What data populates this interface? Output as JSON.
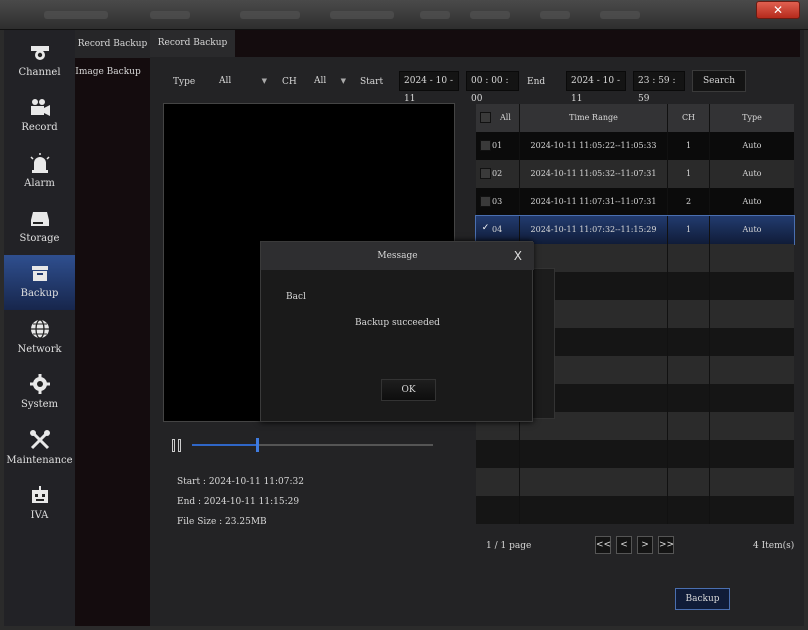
{
  "window": {
    "close_glyph": "✕"
  },
  "sidebar": {
    "items": [
      {
        "label": "Channel",
        "icon": "camera-icon"
      },
      {
        "label": "Record",
        "icon": "video-camera-icon"
      },
      {
        "label": "Alarm",
        "icon": "alarm-light-icon"
      },
      {
        "label": "Storage",
        "icon": "hard-drive-icon"
      },
      {
        "label": "Backup",
        "icon": "backup-box-icon",
        "active": true
      },
      {
        "label": "Network",
        "icon": "globe-icon"
      },
      {
        "label": "System",
        "icon": "gear-icon"
      },
      {
        "label": "Maintenance",
        "icon": "tools-icon"
      },
      {
        "label": "IVA",
        "icon": "robot-icon"
      }
    ]
  },
  "subnav": {
    "items": [
      "Record Backup",
      "Image Backup"
    ]
  },
  "tabs": {
    "active": "Record Backup"
  },
  "filters": {
    "type_label": "Type",
    "type_value": "All",
    "ch_label": "CH",
    "ch_value": "All",
    "start_label": "Start",
    "start_date": "2024 - 10 - 11",
    "start_time": "00 : 00 : 00",
    "end_label": "End",
    "end_date": "2024 - 10 - 11",
    "end_time": "23 : 59 : 59",
    "search_label": "Search"
  },
  "player": {
    "progress": 0.27,
    "start": "Start : 2024-10-11     11:07:32",
    "end": "End : 2024-10-11     11:15:29",
    "file_size": "File Size : 23.25MB"
  },
  "table": {
    "headers": {
      "all": "All",
      "time_range": "Time Range",
      "ch": "CH",
      "type": "Type"
    },
    "rows": [
      {
        "no": "01",
        "time": "2024-10-11 11:05:22--11:05:33",
        "ch": "1",
        "type": "Auto",
        "checked": false
      },
      {
        "no": "02",
        "time": "2024-10-11 11:05:32--11:07:31",
        "ch": "1",
        "type": "Auto",
        "checked": false
      },
      {
        "no": "03",
        "time": "2024-10-11 11:07:31--11:07:31",
        "ch": "2",
        "type": "Auto",
        "checked": false
      },
      {
        "no": "04",
        "time": "2024-10-11 11:07:32--11:15:29",
        "ch": "1",
        "type": "Auto",
        "checked": true
      }
    ],
    "check_glyph": "✓"
  },
  "pagination": {
    "page": "1 / 1  page",
    "first": "<<",
    "prev": "<",
    "next": ">",
    "last": ">>",
    "items": "4 Item(s)"
  },
  "backup_button": "Backup",
  "dialog": {
    "title": "Message",
    "close": "X",
    "message": "Backup succeeded",
    "ok": "OK",
    "behind_label": "Bacl"
  }
}
